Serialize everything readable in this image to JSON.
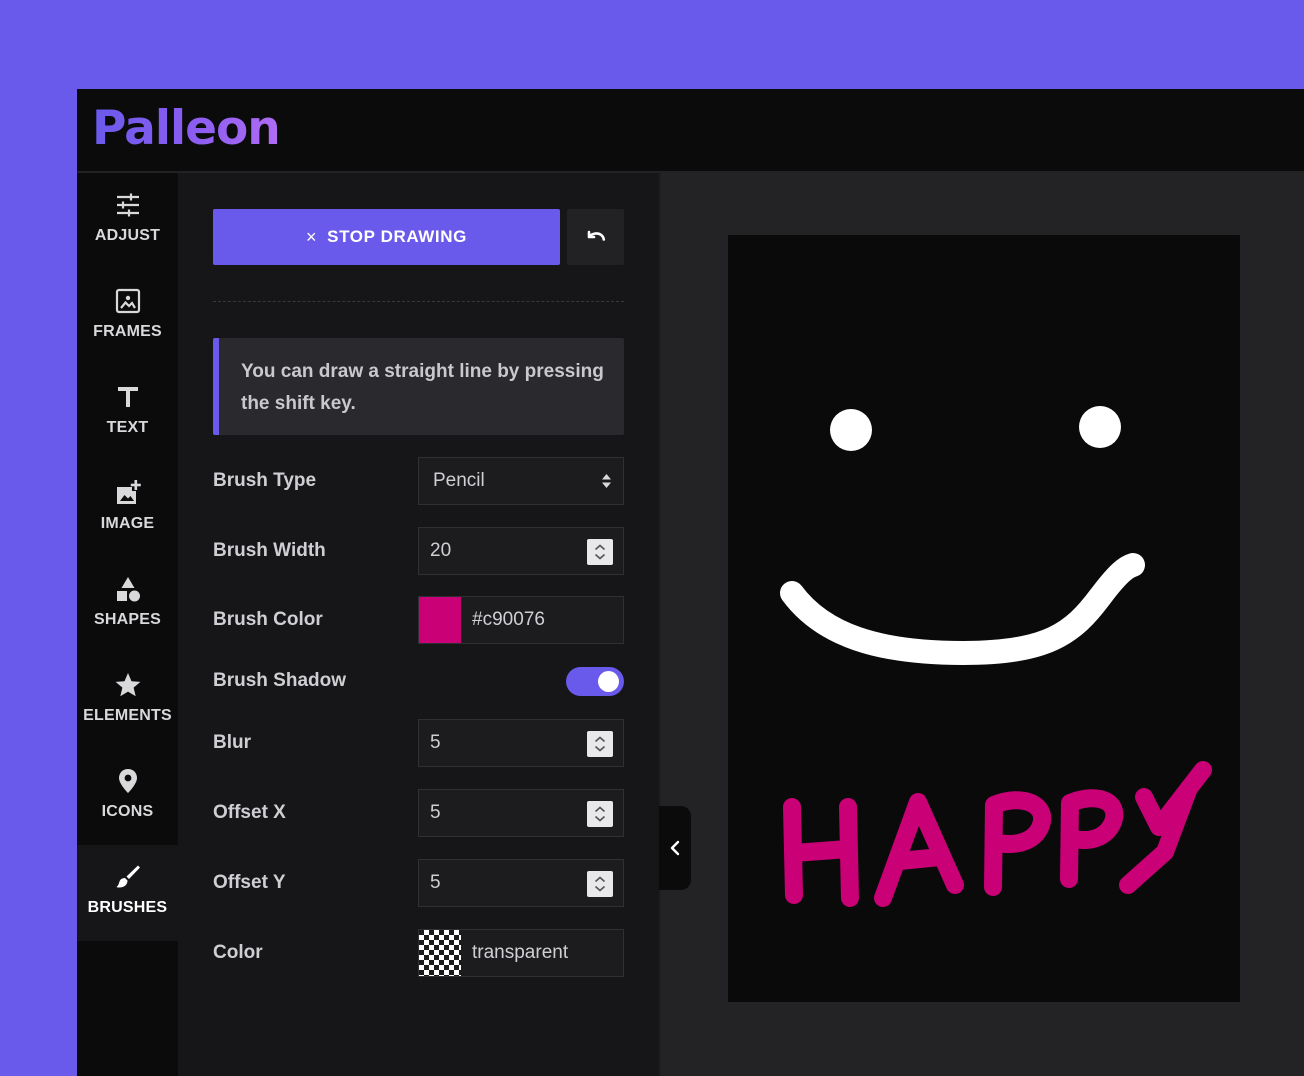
{
  "app": {
    "logo": "Palleon"
  },
  "sidebar": {
    "items": [
      {
        "label": "ADJUST",
        "icon": "sliders-icon",
        "active": false
      },
      {
        "label": "FRAMES",
        "icon": "frame-icon",
        "active": false
      },
      {
        "label": "TEXT",
        "icon": "text-icon",
        "active": false
      },
      {
        "label": "IMAGE",
        "icon": "add-image-icon",
        "active": false
      },
      {
        "label": "SHAPES",
        "icon": "shapes-icon",
        "active": false
      },
      {
        "label": "ELEMENTS",
        "icon": "star-icon",
        "active": false
      },
      {
        "label": "ICONS",
        "icon": "location-pin-icon",
        "active": false
      },
      {
        "label": "BRUSHES",
        "icon": "brush-icon",
        "active": true
      }
    ]
  },
  "panel": {
    "stop_icon": "×",
    "stop_label": "STOP DRAWING",
    "undo_icon": "undo-icon",
    "notice": "You can draw a straight line by pressing the shift key.",
    "brush_type": {
      "label": "Brush Type",
      "value": "Pencil"
    },
    "brush_width": {
      "label": "Brush Width",
      "value": "20"
    },
    "brush_color": {
      "label": "Brush Color",
      "value": "#c90076",
      "swatch": "#c90076"
    },
    "brush_shadow": {
      "label": "Brush Shadow",
      "enabled": true
    },
    "blur": {
      "label": "Blur",
      "value": "5"
    },
    "offset_x": {
      "label": "Offset X",
      "value": "5"
    },
    "offset_y": {
      "label": "Offset Y",
      "value": "5"
    },
    "shadow_color": {
      "label": "Color",
      "value": "transparent"
    }
  },
  "colors": {
    "accent": "#6a5aeb",
    "brush": "#c90076",
    "drawing_white": "#ffffff"
  }
}
